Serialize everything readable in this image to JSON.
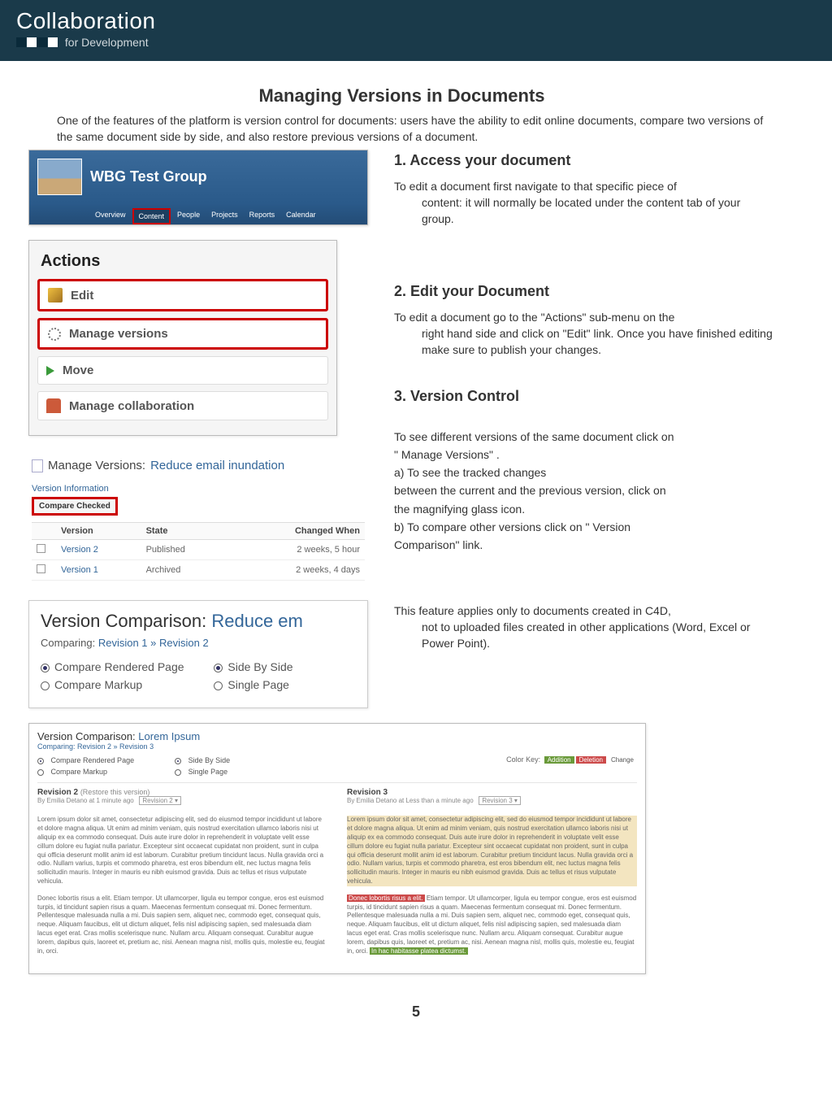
{
  "header": {
    "title": "Collaboration",
    "subtitle": "for Development"
  },
  "page": {
    "title": "Managing Versions in Documents",
    "intro": "One of the features of the platform is version control for documents: users have the ability to edit online documents, compare two versions of the same document side by side, and also restore previous versions of a document.",
    "footer_page_number": "5"
  },
  "steps": {
    "s1": {
      "heading": "1. Access your document",
      "body_lead": "To edit a document first navigate to that specific piece of",
      "body_rest": "content: it will normally be located under the content tab of your group."
    },
    "s2": {
      "heading": "2. Edit your Document",
      "body_lead": "To edit a document go to the \"Actions\" sub-menu on the",
      "body_rest": "right hand side and click on \"Edit\" link. Once you have finished editing make sure to publish your changes."
    },
    "s3": {
      "heading": "3. Version Control",
      "p1": "To see different versions of the same document click on",
      "p2": "\" Manage Versions\" .",
      "p3": "a) To see the tracked changes",
      "p4": "between the current and the previous version, click on",
      "p5": "the magnifying glass icon.",
      "p6": "b) To compare other versions click on \" Version",
      "p7": "Comparison\" link."
    },
    "note_lead": "This feature applies only to documents created in C4D,",
    "note_rest": "not to uploaded files created in other applications (Word, Excel or Power Point)."
  },
  "group_shot": {
    "name": "WBG Test Group",
    "tabs": [
      "Overview",
      "Content",
      "People",
      "Projects",
      "Reports",
      "Calendar"
    ],
    "selected_tab_index": 1
  },
  "actions_shot": {
    "title": "Actions",
    "items": [
      {
        "label": "Edit",
        "icon": "edit",
        "highlight": true
      },
      {
        "label": "Manage versions",
        "icon": "gear",
        "highlight": true
      },
      {
        "label": "Move",
        "icon": "arrow",
        "highlight": false
      },
      {
        "label": "Manage collaboration",
        "icon": "person",
        "highlight": false
      }
    ]
  },
  "manage_versions_shot": {
    "prefix": "Manage Versions:",
    "doc": "Reduce email inundation",
    "info_tab": "Version Information",
    "compare_button": "Compare Checked",
    "columns": {
      "version": "Version",
      "state": "State",
      "changed": "Changed When"
    },
    "rows": [
      {
        "version": "Version 2",
        "state": "Published",
        "changed": "2 weeks, 5 hour"
      },
      {
        "version": "Version 1",
        "state": "Archived",
        "changed": "2 weeks, 4 days"
      }
    ]
  },
  "vc_shot": {
    "title_prefix": "Version Comparison:",
    "title_doc": "Reduce em",
    "sub_prefix": "Comparing:",
    "sub_rev": "Revision 1 » Revision 2",
    "opt_rendered": "Compare Rendered Page",
    "opt_markup": "Compare Markup",
    "opt_side": "Side By Side",
    "opt_single": "Single Page"
  },
  "wide_shot": {
    "title_prefix": "Version Comparison:",
    "title_doc": "Lorem Ipsum",
    "sub": "Comparing: Revision 2 » Revision 3",
    "opt_rendered": "Compare Rendered Page",
    "opt_markup": "Compare Markup",
    "opt_side": "Side By Side",
    "opt_single": "Single Page",
    "color_key_label": "Color Key:",
    "key_add": "Addition",
    "key_del": "Deletion",
    "key_chg": "Change",
    "left": {
      "rev": "Revision 2",
      "rest": "(Restore this version)",
      "meta_by": "By Emilia Detano at 1 minute ago",
      "meta_sel": "Revision 2 ▾",
      "para1": "Lorem ipsum dolor sit amet, consectetur adipiscing elit, sed do eiusmod tempor incididunt ut labore et dolore magna aliqua. Ut enim ad minim veniam, quis nostrud exercitation ullamco laboris nisi ut aliquip ex ea commodo consequat. Duis aute irure dolor in reprehenderit in voluptate velit esse cillum dolore eu fugiat nulla pariatur. Excepteur sint occaecat cupidatat non proident, sunt in culpa qui officia deserunt mollit anim id est laborum. Curabitur pretium tincidunt lacus. Nulla gravida orci a odio. Nullam varius, turpis et commodo pharetra, est eros bibendum elit, nec luctus magna felis sollicitudin mauris. Integer in mauris eu nibh euismod gravida. Duis ac tellus et risus vulputate vehicula.",
      "para2": "Donec lobortis risus a elit. Etiam tempor. Ut ullamcorper, ligula eu tempor congue, eros est euismod turpis, id tincidunt sapien risus a quam. Maecenas fermentum consequat mi. Donec fermentum. Pellentesque malesuada nulla a mi. Duis sapien sem, aliquet nec, commodo eget, consequat quis, neque. Aliquam faucibus, elit ut dictum aliquet, felis nisl adipiscing sapien, sed malesuada diam lacus eget erat. Cras mollis scelerisque nunc. Nullam arcu. Aliquam consequat. Curabitur augue lorem, dapibus quis, laoreet et, pretium ac, nisi. Aenean magna nisl, mollis quis, molestie eu, feugiat in, orci."
    },
    "right": {
      "rev": "Revision 3",
      "meta_by": "By Emilia Detano at Less than a minute ago",
      "meta_sel": "Revision 3 ▾",
      "para1": "Lorem ipsum dolor sit amet, consectetur adipiscing elit, sed do eiusmod tempor incididunt ut labore et dolore magna aliqua. Ut enim ad minim veniam, quis nostrud exercitation ullamco laboris nisi ut aliquip ex ea commodo consequat. Duis aute irure dolor in reprehenderit in voluptate velit esse cillum dolore eu fugiat nulla pariatur. Excepteur sint occaecat cupidatat non proident, sunt in culpa qui officia deserunt mollit anim id est laborum. Curabitur pretium tincidunt lacus. Nulla gravida orci a odio. Nullam varius, turpis et commodo pharetra, est eros bibendum elit, nec luctus magna felis sollicitudin mauris. Integer in mauris eu nibh euismod gravida. Duis ac tellus et risus vulputate vehicula.",
      "p2_del": "Donec lobortis risus a elit.",
      "p2_mid": " Etiam tempor. Ut ullamcorper, ligula eu tempor congue, eros est euismod turpis, id tincidunt sapien risus a quam. Maecenas fermentum consequat mi. Donec fermentum. Pellentesque malesuada nulla a mi. Duis sapien sem, aliquet nec, commodo eget, consequat quis, neque. Aliquam faucibus, elit ut dictum aliquet, felis nisl adipiscing sapien, sed malesuada diam lacus eget erat. Cras mollis scelerisque nunc. Nullam arcu. Aliquam consequat. Curabitur augue lorem, dapibus quis, laoreet et, pretium ac, nisi. Aenean magna nisl, mollis quis, molestie eu, feugiat in, orci. ",
      "p2_add": "In hac habitasse platea dictumst."
    }
  }
}
